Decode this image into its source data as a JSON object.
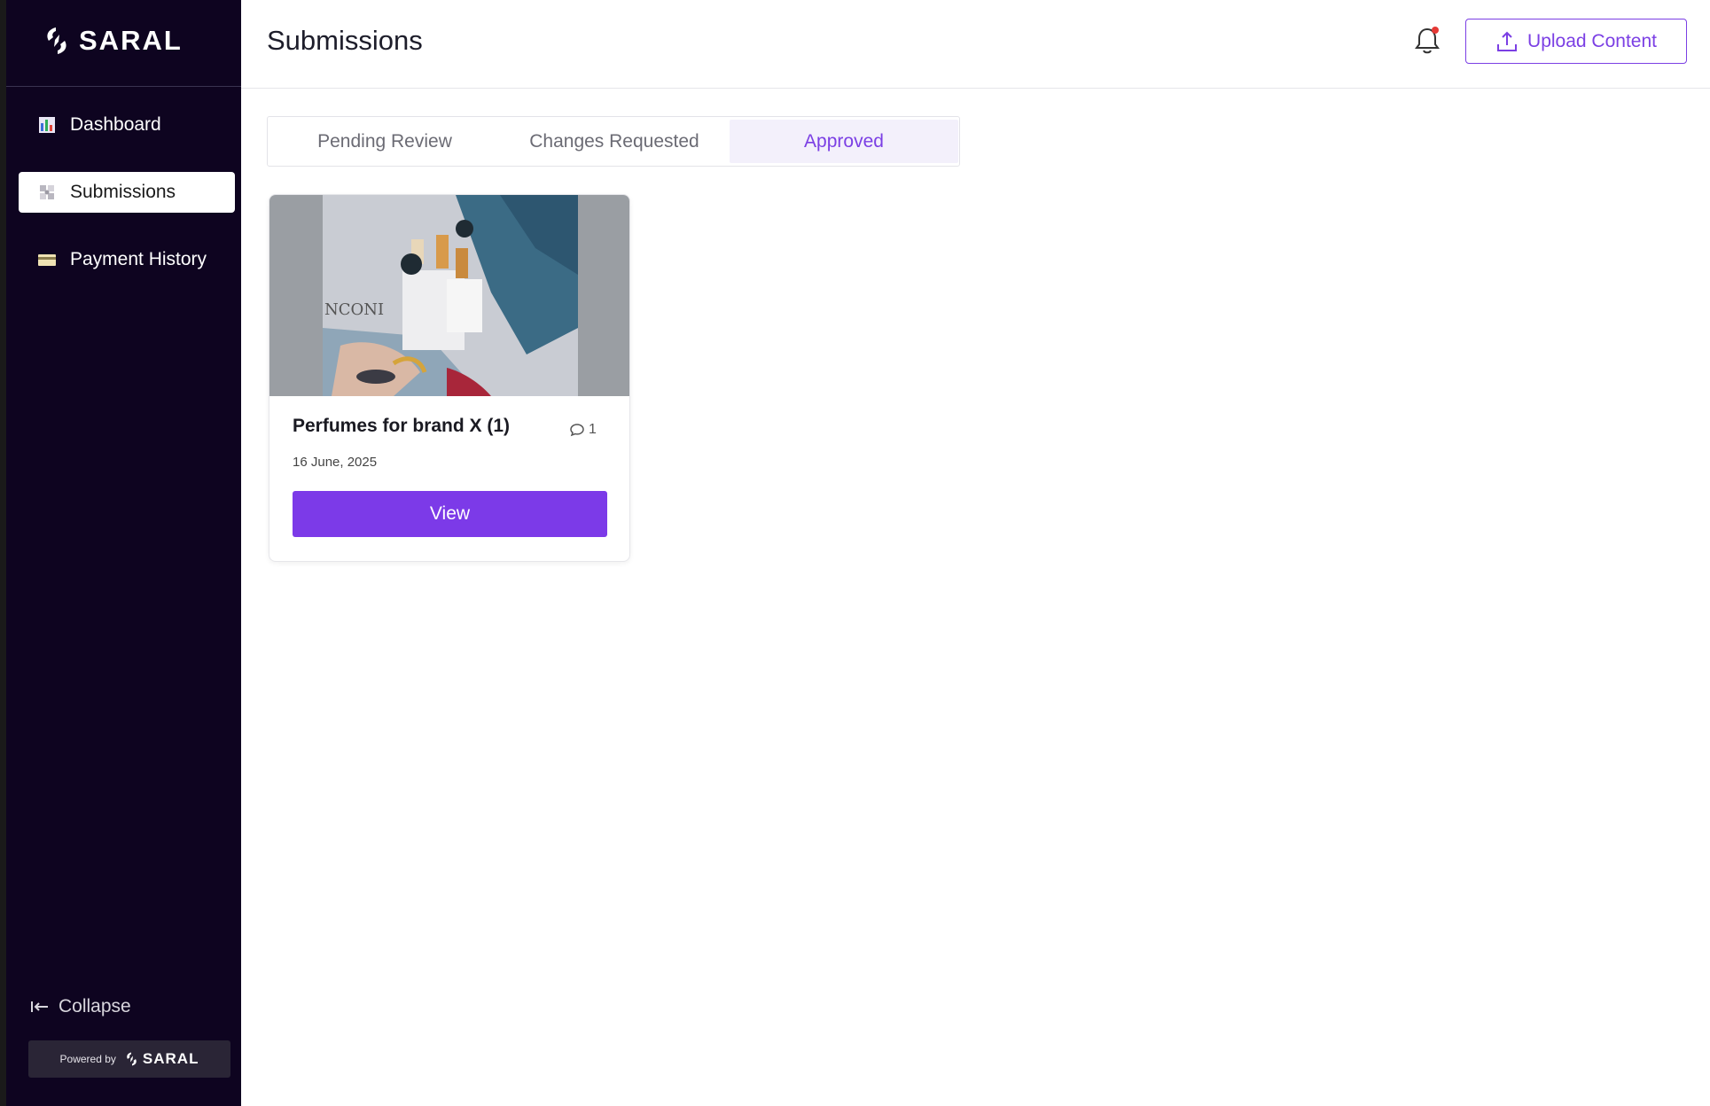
{
  "brand": {
    "name": "SARAL"
  },
  "sidebar": {
    "items": [
      {
        "label": "Dashboard",
        "icon": "bar-chart-icon",
        "active": false
      },
      {
        "label": "Submissions",
        "icon": "puzzle-icon",
        "active": true
      },
      {
        "label": "Payment History",
        "icon": "credit-card-icon",
        "active": false
      }
    ],
    "collapse_label": "Collapse",
    "powered_by": "Powered by",
    "powered_brand": "SARAL"
  },
  "header": {
    "title": "Submissions",
    "notification_icon": "bell-icon",
    "upload_label": "Upload Content"
  },
  "tabs": [
    {
      "label": "Pending Review",
      "active": false
    },
    {
      "label": "Changes Requested",
      "active": false
    },
    {
      "label": "Approved",
      "active": true
    }
  ],
  "submissions": [
    {
      "title": "Perfumes for brand X (1)",
      "date": "16 June, 2025",
      "comment_count": "1",
      "action_label": "View"
    }
  ],
  "colors": {
    "sidebar_bg": "#0e0420",
    "accent": "#7c3ae8",
    "notification_dot": "#e53935"
  }
}
